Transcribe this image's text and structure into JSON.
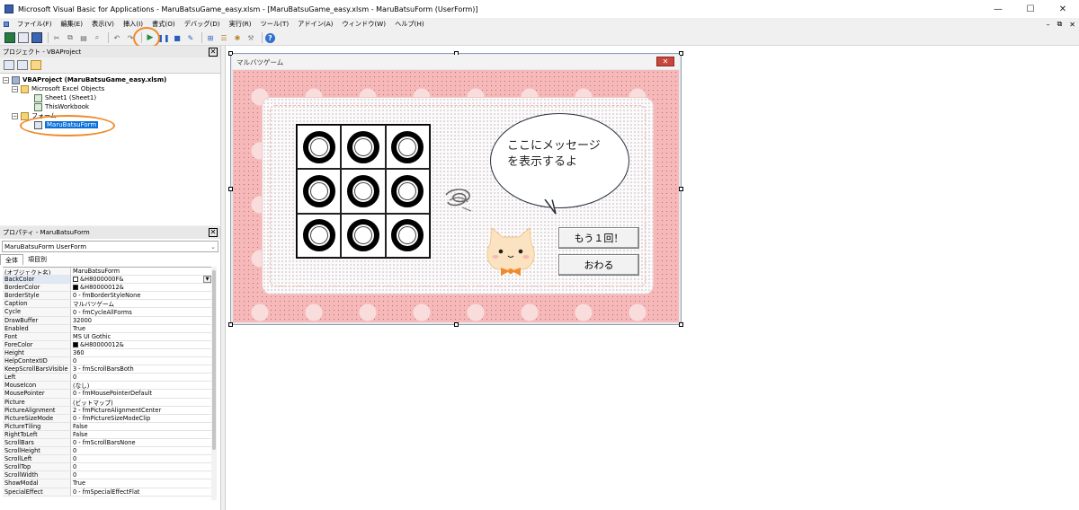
{
  "window": {
    "title": "Microsoft Visual Basic for Applications - MaruBatsuGame_easy.xlsm - [MaruBatsuGame_easy.xlsm - MaruBatsuForm (UserForm)]",
    "minimize": "—",
    "maximize": "☐",
    "close": "✕"
  },
  "menu": {
    "items": [
      "ファイル(F)",
      "編集(E)",
      "表示(V)",
      "挿入(I)",
      "書式(O)",
      "デバッグ(D)",
      "実行(R)",
      "ツール(T)",
      "アドイン(A)",
      "ウィンドウ(W)",
      "ヘルプ(H)"
    ],
    "mdi_min": "–",
    "mdi_restore": "⧉",
    "mdi_close": "✕"
  },
  "toolbar": {
    "help": "?"
  },
  "project_pane": {
    "title": "プロジェクト - VBAProject",
    "close": "✕",
    "tree": {
      "root": "VBAProject (MaruBatsuGame_easy.xlsm)",
      "excel_objects": "Microsoft Excel Objects",
      "sheet1": "Sheet1 (Sheet1)",
      "thisworkbook": "ThisWorkbook",
      "forms": "フォーム",
      "form": "MaruBatsuForm",
      "expander": "−"
    }
  },
  "properties_pane": {
    "title": "プロパティ - MaruBatsuForm",
    "close": "✕",
    "object": "MaruBatsuForm UserForm",
    "tabs": [
      "全体",
      "項目別"
    ],
    "rows": [
      {
        "k": "(オブジェクト名)",
        "v": "MaruBatsuForm"
      },
      {
        "k": "BackColor",
        "v": "&H8000000F&",
        "swatch": "#ffffff",
        "dropdown": "▼"
      },
      {
        "k": "BorderColor",
        "v": "&H80000012&",
        "swatch": "#000000"
      },
      {
        "k": "BorderStyle",
        "v": "0 - fmBorderStyleNone"
      },
      {
        "k": "Caption",
        "v": "マルバツゲーム"
      },
      {
        "k": "Cycle",
        "v": "0 - fmCycleAllForms"
      },
      {
        "k": "DrawBuffer",
        "v": "32000"
      },
      {
        "k": "Enabled",
        "v": "True"
      },
      {
        "k": "Font",
        "v": "MS UI Gothic"
      },
      {
        "k": "ForeColor",
        "v": "&H80000012&",
        "swatch": "#000000"
      },
      {
        "k": "Height",
        "v": "360"
      },
      {
        "k": "HelpContextID",
        "v": "0"
      },
      {
        "k": "KeepScrollBarsVisible",
        "v": "3 - fmScrollBarsBoth"
      },
      {
        "k": "Left",
        "v": "0"
      },
      {
        "k": "MouseIcon",
        "v": "(なし)"
      },
      {
        "k": "MousePointer",
        "v": "0 - fmMousePointerDefault"
      },
      {
        "k": "Picture",
        "v": "(ビットマップ)"
      },
      {
        "k": "PictureAlignment",
        "v": "2 - fmPictureAlignmentCenter"
      },
      {
        "k": "PictureSizeMode",
        "v": "0 - fmPictureSizeModeClip"
      },
      {
        "k": "PictureTiling",
        "v": "False"
      },
      {
        "k": "RightToLeft",
        "v": "False"
      },
      {
        "k": "ScrollBars",
        "v": "0 - fmScrollBarsNone"
      },
      {
        "k": "ScrollHeight",
        "v": "0"
      },
      {
        "k": "ScrollLeft",
        "v": "0"
      },
      {
        "k": "ScrollTop",
        "v": "0"
      },
      {
        "k": "ScrollWidth",
        "v": "0"
      },
      {
        "k": "ShowModal",
        "v": "True"
      },
      {
        "k": "SpecialEffect",
        "v": "0 - fmSpecialEffectFlat"
      }
    ]
  },
  "form": {
    "caption": "マルバツゲーム",
    "close": "✕",
    "message": "ここにメッセージ\nを表示するよ",
    "retry_button": "もう１回！",
    "end_button": "おわる",
    "board_cells": 9
  }
}
